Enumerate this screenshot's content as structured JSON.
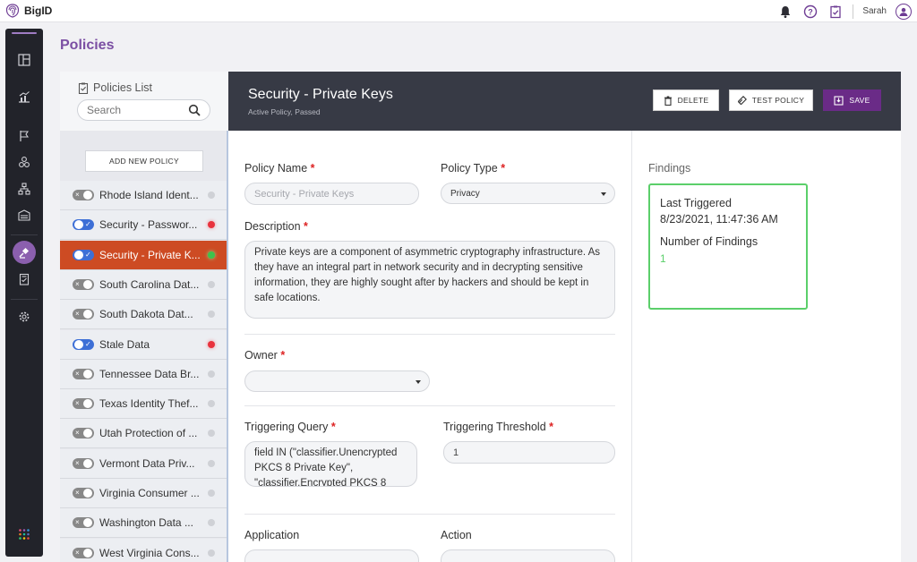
{
  "app": {
    "brand": "BigID",
    "user": "Sarah"
  },
  "page": {
    "title": "Policies"
  },
  "list": {
    "title": "Policies List",
    "search_placeholder": "Search",
    "add_button": "ADD NEW POLICY",
    "items": [
      {
        "name": "Rhode Island Ident...",
        "enabled": false,
        "status": "none"
      },
      {
        "name": "Security - Passwor...",
        "enabled": true,
        "status": "red"
      },
      {
        "name": "Security - Private K...",
        "enabled": true,
        "status": "green",
        "selected": true
      },
      {
        "name": "South Carolina Dat...",
        "enabled": false,
        "status": "none"
      },
      {
        "name": "South Dakota Dat...",
        "enabled": false,
        "status": "none"
      },
      {
        "name": "Stale Data",
        "enabled": true,
        "status": "red"
      },
      {
        "name": "Tennessee Data Br...",
        "enabled": false,
        "status": "none"
      },
      {
        "name": "Texas Identity Thef...",
        "enabled": false,
        "status": "none"
      },
      {
        "name": "Utah Protection of ...",
        "enabled": false,
        "status": "none"
      },
      {
        "name": "Vermont Data Priv...",
        "enabled": false,
        "status": "none"
      },
      {
        "name": "Virginia Consumer ...",
        "enabled": false,
        "status": "none"
      },
      {
        "name": "Washington Data ...",
        "enabled": false,
        "status": "none"
      },
      {
        "name": "West Virginia Cons...",
        "enabled": false,
        "status": "none"
      }
    ]
  },
  "detail": {
    "title": "Security - Private Keys",
    "subtitle": "Active Policy,  Passed",
    "delete_label": "DELETE",
    "test_label": "TEST POLICY",
    "save_label": "SAVE"
  },
  "form": {
    "policy_name_label": "Policy Name",
    "policy_name_value": "Security - Private Keys",
    "policy_type_label": "Policy Type",
    "policy_type_value": "Privacy",
    "description_label": "Description",
    "description_value": "Private keys are a component of asymmetric cryptography infrastructure. As they have an integral part in network security and in decrypting sensitive information, they are highly sought after by hackers and should be kept in safe locations.",
    "owner_label": "Owner",
    "owner_value": "",
    "triggering_query_label": "Triggering Query",
    "triggering_query_value": "field IN (\"classifier.Unencrypted PKCS 8 Private Key\", \"classifier.Encrypted PKCS 8",
    "threshold_label": "Triggering Threshold",
    "threshold_value": "1",
    "application_label": "Application",
    "action_label": "Action"
  },
  "findings": {
    "title": "Findings",
    "last_triggered_label": "Last Triggered",
    "last_triggered_value": "8/23/2021, 11:47:36 AM",
    "count_label": "Number of Findings",
    "count_value": "1"
  },
  "colors": {
    "accent": "#7b4fa3",
    "selected_row": "#cd4b23",
    "header_dark": "#373a45",
    "save": "#6a2b87",
    "toggle_on": "#3d6fd6",
    "status_red": "#e8323d",
    "status_green": "#3ec24c"
  }
}
